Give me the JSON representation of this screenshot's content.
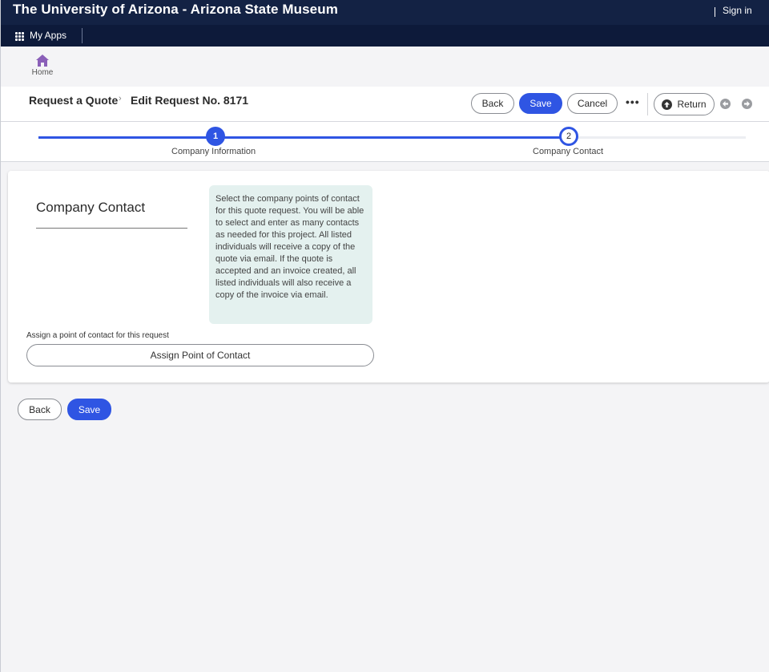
{
  "topbar": {
    "title": "The University of Arizona - Arizona State Museum",
    "sign_in": "Sign in"
  },
  "appbar": {
    "my_apps": "My Apps"
  },
  "homebar": {
    "home_label": "Home"
  },
  "breadcrumb": {
    "items": [
      "Request a Quote",
      "Edit Request No. 8171"
    ]
  },
  "command_bar": {
    "back": "Back",
    "save": "Save",
    "cancel": "Cancel",
    "more": "•••",
    "return": "Return"
  },
  "stepper": {
    "steps": [
      {
        "number": "1",
        "label": "Company Information",
        "status": "complete"
      },
      {
        "number": "2",
        "label": "Company Contact",
        "status": "current"
      }
    ]
  },
  "section": {
    "title": "Company Contact",
    "info": "Select the company points of contact for this quote request. You will be able to select and enter as many contacts as needed for this project. All listed individuals will receive a copy of the quote via email. If the quote is accepted and an invoice created, all listed individuals will also receive a copy of the invoice via email.",
    "assign_label": "Assign a point of contact for this request",
    "assign_button": "Assign Point of Contact"
  },
  "footer_actions": {
    "back": "Back",
    "save": "Save"
  },
  "colors": {
    "header": "#132244",
    "appbar": "#0d1a3a",
    "primary": "#2f55e3",
    "home_icon": "#8a5fb8",
    "info_box": "#e4f1ef"
  }
}
